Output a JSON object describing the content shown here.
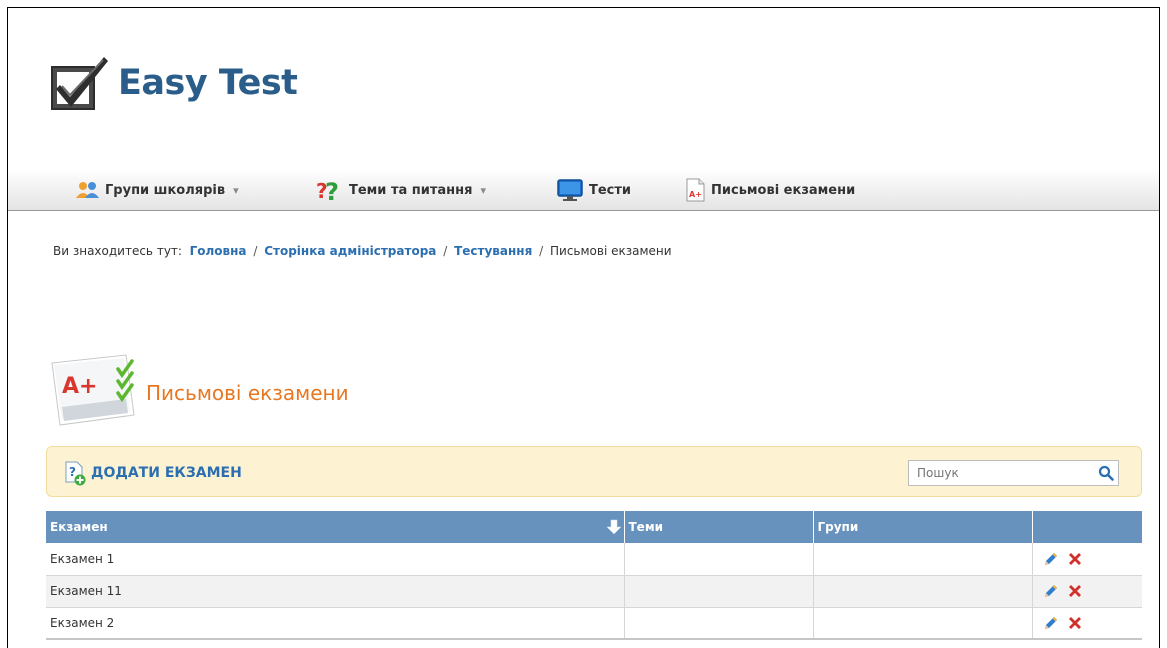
{
  "app": {
    "logo_text": "Easy Test"
  },
  "nav": {
    "items": [
      {
        "label": "Групи школярів",
        "has_dropdown": true,
        "icon": "users-icon"
      },
      {
        "label": "Теми та питання",
        "has_dropdown": true,
        "icon": "question-icon"
      },
      {
        "label": "Тести",
        "has_dropdown": false,
        "icon": "monitor-icon"
      },
      {
        "label": "Письмові екзамени",
        "has_dropdown": false,
        "icon": "document-grade-icon"
      }
    ],
    "caret": "▾"
  },
  "breadcrumb": {
    "prefix": "Ви знаходитесь тут:",
    "links": [
      "Головна",
      "Сторінка адміністратора",
      "Тестування"
    ],
    "current": "Письмові екзамени",
    "separator": "/"
  },
  "page": {
    "title": "Письмові екзамени"
  },
  "toolbar": {
    "add_label": "ДОДАТИ ЕКЗАМЕН",
    "search_placeholder": "Пошук"
  },
  "table": {
    "columns": [
      "Екзамен",
      "Теми",
      "Групи",
      ""
    ],
    "rows": [
      {
        "exam": "Екзамен 1",
        "topics": "",
        "groups": ""
      },
      {
        "exam": "Екзамен 11",
        "topics": "",
        "groups": ""
      },
      {
        "exam": "Екзамен 2",
        "topics": "",
        "groups": ""
      }
    ]
  },
  "colors": {
    "brand": "#2a5d8a",
    "title_orange": "#e87722",
    "link_blue": "#2b6fb0",
    "table_header": "#6792bd",
    "toolbar_bg": "#fdf3d3"
  }
}
